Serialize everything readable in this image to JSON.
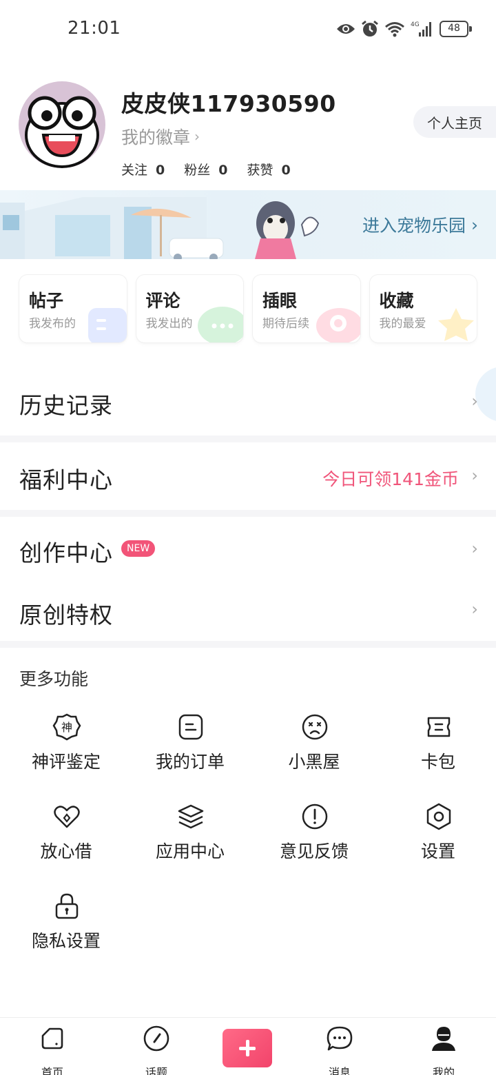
{
  "status_bar": {
    "time": "21:01",
    "network": "4G",
    "battery": "48"
  },
  "profile": {
    "username": "皮皮侠117930590",
    "badges_label": "我的徽章",
    "homepage_button": "个人主页",
    "stats": [
      {
        "label": "关注",
        "value": "0"
      },
      {
        "label": "粉丝",
        "value": "0"
      },
      {
        "label": "获赞",
        "value": "0"
      }
    ]
  },
  "banner": {
    "label": "进入宠物乐园"
  },
  "quick_cards": [
    {
      "title": "帖子",
      "subtitle": "我发布的",
      "icon": "post-doc-icon",
      "color": "#dde7ff"
    },
    {
      "title": "评论",
      "subtitle": "我发出的",
      "icon": "comment-bubble-icon",
      "color": "#d9f5df"
    },
    {
      "title": "插眼",
      "subtitle": "期待后续",
      "icon": "eye-mark-icon",
      "color": "#ffdfe5"
    },
    {
      "title": "收藏",
      "subtitle": "我的最爱",
      "icon": "star-icon",
      "color": "#fff1c9"
    }
  ],
  "menu": {
    "history": "历史记录",
    "welfare": "福利中心",
    "welfare_right": "今日可领141金币",
    "creation": "创作中心",
    "creation_badge": "NEW",
    "original": "原创特权"
  },
  "more_functions": {
    "title": "更多功能",
    "items": [
      {
        "label": "神评鉴定",
        "icon": "shen-badge-icon"
      },
      {
        "label": "我的订单",
        "icon": "order-icon"
      },
      {
        "label": "小黑屋",
        "icon": "sad-face-icon"
      },
      {
        "label": "卡包",
        "icon": "card-wallet-icon"
      },
      {
        "label": "放心借",
        "icon": "heart-loan-icon"
      },
      {
        "label": "应用中心",
        "icon": "layers-icon"
      },
      {
        "label": "意见反馈",
        "icon": "exclamation-circle-icon"
      },
      {
        "label": "设置",
        "icon": "hex-gear-icon"
      },
      {
        "label": "隐私设置",
        "icon": "lock-icon"
      }
    ]
  },
  "tabbar": [
    {
      "label": "首页",
      "icon": "home-icon"
    },
    {
      "label": "话题",
      "icon": "compass-icon"
    },
    {
      "label": "",
      "icon": "plus-icon"
    },
    {
      "label": "消息",
      "icon": "chat-icon"
    },
    {
      "label": "我的",
      "icon": "user-icon"
    }
  ],
  "colors": {
    "accent": "#f25478",
    "banner_text": "#3d7a9a"
  }
}
